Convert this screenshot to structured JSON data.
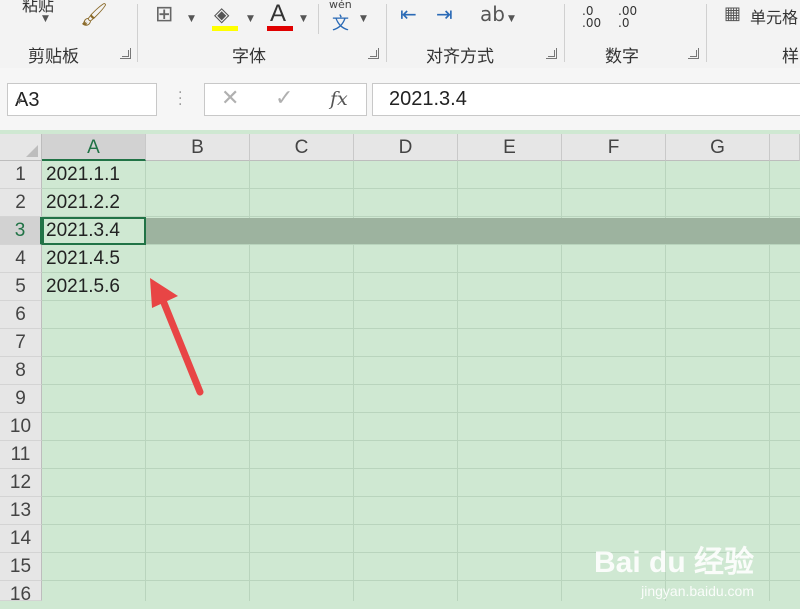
{
  "ribbon": {
    "paste_label": "粘贴",
    "groups": [
      "剪贴板",
      "字体",
      "对齐方式",
      "数字"
    ],
    "cell_styles_label": "单元格",
    "styles_partial": "样",
    "phonetic_label": "wén",
    "phonetic_char": "文",
    "font_color_glyph": "A",
    "dec_increase": ".00",
    "dec_decrease": ".0"
  },
  "formula_bar": {
    "name_box": "A3",
    "fx_label": "fx",
    "formula": "2021.3.4"
  },
  "columns": [
    "A",
    "B",
    "C",
    "D",
    "E",
    "F",
    "G"
  ],
  "rows": [
    "1",
    "2",
    "3",
    "4",
    "5",
    "6",
    "7",
    "8",
    "9",
    "10",
    "11",
    "12",
    "13",
    "14",
    "15",
    "16"
  ],
  "cells": [
    "2021.1.1",
    "2021.2.2",
    "2021.3.4",
    "2021.4.5",
    "2021.5.6"
  ],
  "watermark": {
    "main": "Bai du 经验",
    "sub": "jingyan.baidu.com"
  },
  "colors": {
    "accent": "#217346",
    "sheet_bg": "#cfe8d2",
    "arrow": "#e84545",
    "highlight_yellow": "#ffff00",
    "font_red": "#e00000"
  }
}
